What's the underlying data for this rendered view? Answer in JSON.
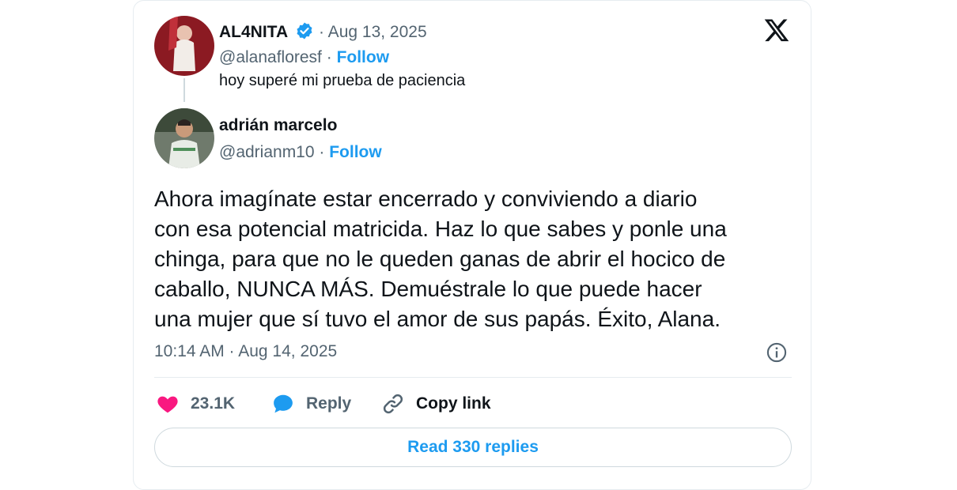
{
  "parent_tweet": {
    "author_name": "AL4NITA",
    "date": "· Aug 13, 2025",
    "handle": "@alanafloresf ·",
    "follow_label": "Follow",
    "text": "hoy superé mi prueba de paciencia"
  },
  "main_tweet": {
    "author_name": "adrián marcelo",
    "handle": "@adrianm10 ·",
    "follow_label": "Follow",
    "body_lines": [
      "Ahora imagínate estar encerrado y conviviendo a diario",
      "con esa potencial matricida. Haz lo que sabes y ponle una",
      "chinga, para que no le queden ganas de abrir el hocico de",
      "caballo, NUNCA MÁS. Demuéstrale lo que puede hacer",
      "una mujer que sí tuvo el amor de sus papás. Éxito, Alana."
    ],
    "timestamp": "10:14 AM · Aug 14, 2025"
  },
  "actions": {
    "like_count": "23.1K",
    "reply_label": "Reply",
    "copy_label": "Copy link"
  },
  "read_replies_label": "Read 330 replies",
  "icons": {
    "platform": "x-logo-icon",
    "verified": "verified-badge-icon",
    "like": "heart-icon",
    "reply": "speech-bubble-icon",
    "copy": "link-icon",
    "info": "info-icon"
  },
  "colors": {
    "accent": "#1d9bf0",
    "like": "#f91880",
    "text": "#0f1419",
    "muted": "#536471",
    "border": "#cfd9de"
  }
}
